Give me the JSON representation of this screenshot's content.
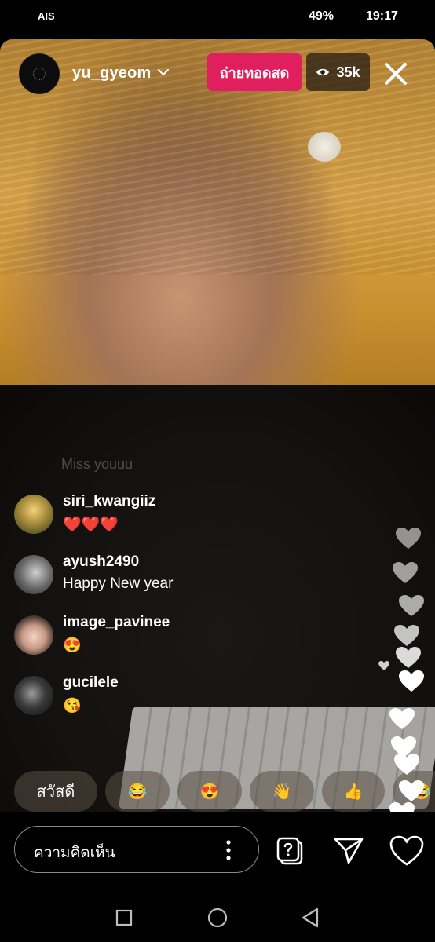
{
  "status_bar": {
    "carrier": "AIS",
    "battery": "49%",
    "time": "19:17"
  },
  "live": {
    "username": "yu_gyeom",
    "live_label": "ถ่ายทอดสด",
    "viewer_count": "35k"
  },
  "comments": {
    "faded_text": "Miss youuu",
    "items": [
      {
        "user": "siri_kwangiiz",
        "text": "❤️❤️❤️"
      },
      {
        "user": "ayush2490",
        "text": "Happy New year"
      },
      {
        "user": "image_pavinee",
        "text": "😍"
      },
      {
        "user": "gucilele",
        "text": "😘"
      }
    ]
  },
  "quick_reactions": [
    "สวัสดี",
    "😂",
    "😍",
    "👋",
    "👍",
    "😂"
  ],
  "composer": {
    "placeholder": "ความคิดเห็น"
  },
  "icons": {
    "close": "close-icon",
    "eye": "eye-icon",
    "chevron": "chevron-down-icon",
    "more": "more-vertical-icon",
    "qa": "question-box-icon",
    "send": "send-icon",
    "like": "heart-icon"
  },
  "colors": {
    "live_badge": "#e0205e",
    "background": "#000000",
    "heart_reaction": "#ffffff"
  }
}
